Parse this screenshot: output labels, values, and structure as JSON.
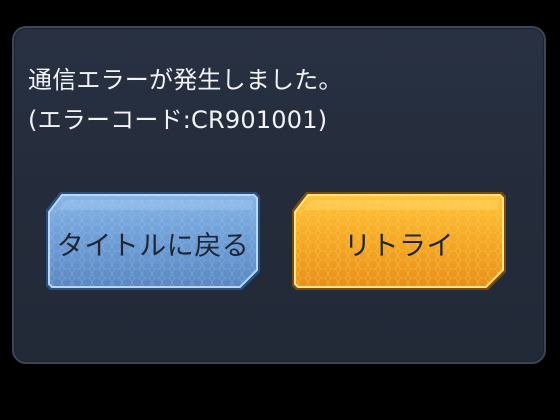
{
  "dialog": {
    "message_line1": "通信エラーが発生しました。",
    "message_line2": "(エラーコード:CR901001)"
  },
  "buttons": {
    "back_to_title_label": "タイトルに戻る",
    "retry_label": "リトライ"
  },
  "colors": {
    "background": "#000000",
    "dialog_bg": "#262e3d",
    "dialog_border": "#3d4656",
    "blue_button": "#6f9fd6",
    "orange_button": "#f3a626",
    "text_light": "#f2f4f8",
    "text_dark": "#1f2533"
  }
}
